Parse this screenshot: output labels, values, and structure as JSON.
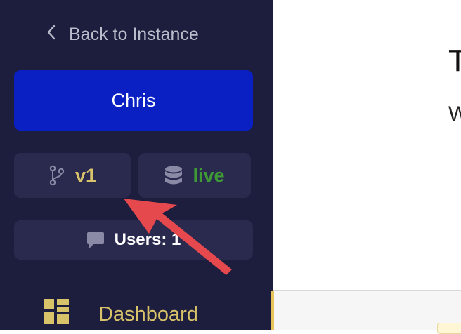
{
  "sidebar": {
    "back_label": "Back to Instance",
    "user_label": "Chris",
    "version_label": "v1",
    "env_label": "live",
    "users_label": "Users: 1",
    "nav": {
      "dashboard_label": "Dashboard"
    }
  },
  "main": {
    "title_fragment": "T",
    "subtitle_fragment": "W"
  },
  "icons": {
    "back": "chevron-left-icon",
    "version": "git-branch-icon",
    "env": "database-icon",
    "users": "chat-bubble-icon",
    "dashboard": "dashboard-grid-icon"
  },
  "colors": {
    "sidebar_bg": "#1d1d3d",
    "primary_button": "#0a20c2",
    "accent_yellow": "#d8c36a",
    "live_green": "#3f9a36",
    "annotation_arrow": "#e5484d"
  }
}
